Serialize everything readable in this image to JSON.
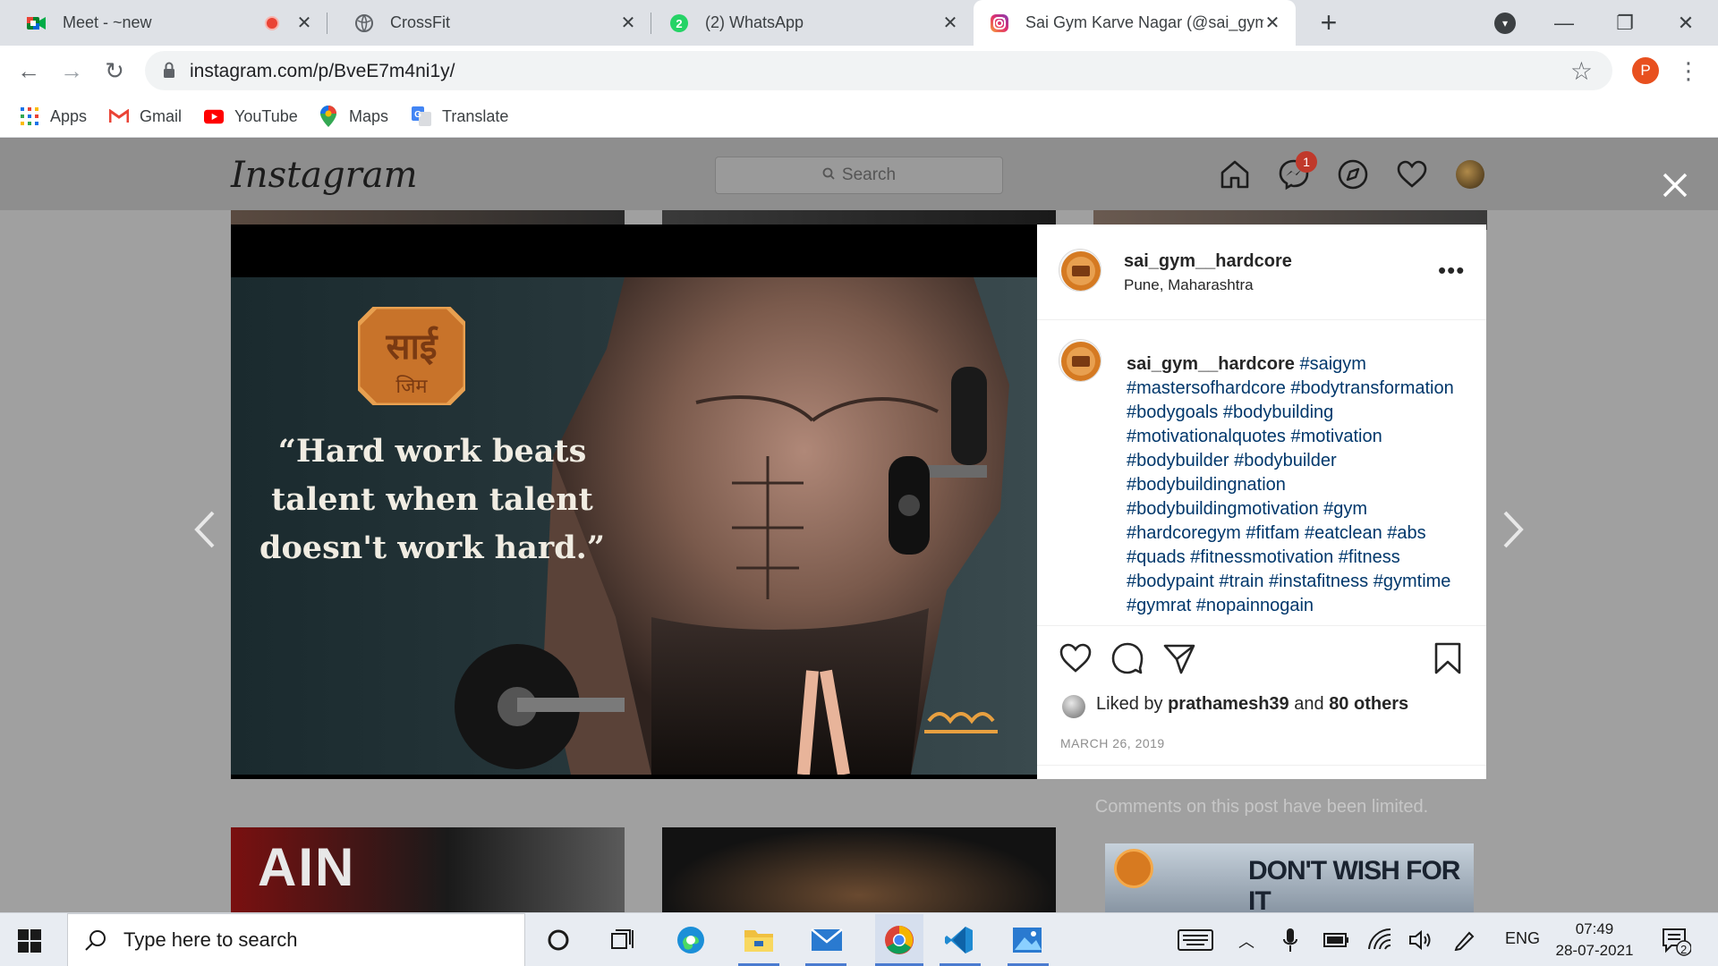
{
  "tabs": [
    {
      "title": "Meet - ~new",
      "icon": "google-meet-icon"
    },
    {
      "title": "CrossFit",
      "icon": "globe-icon"
    },
    {
      "title": "(2) WhatsApp",
      "icon": "whatsapp-icon",
      "badge": "2"
    },
    {
      "title": "Sai Gym Karve Nagar (@sai_gym_",
      "icon": "instagram-icon",
      "active": true
    }
  ],
  "omnibox": {
    "url": "instagram.com/p/BveE7m4ni1y/"
  },
  "profile_initial": "P",
  "bookmarks": [
    {
      "label": "Apps",
      "icon": "apps-grid-icon"
    },
    {
      "label": "Gmail",
      "icon": "gmail-icon"
    },
    {
      "label": "YouTube",
      "icon": "youtube-icon"
    },
    {
      "label": "Maps",
      "icon": "maps-pin-icon"
    },
    {
      "label": "Translate",
      "icon": "translate-icon"
    }
  ],
  "instagram": {
    "logo_text": "Instagram",
    "search_placeholder": "Search",
    "messages_badge": "1"
  },
  "post": {
    "quote": "“Hard work beats talent when talent doesn't work hard.”",
    "logo_glyph": "साई",
    "logo_sub": "जिम",
    "username": "sai_gym__hardcore",
    "location": "Pune, Maharashtra",
    "caption_user": "sai_gym__hardcore",
    "caption_tags": "#saigym #mastersofhardcore #bodytransformation #bodygoals #bodybuilding #motivationalquotes #motivation #bodybuilder #bodybuilder #bodybuildingnation #bodybuildingmotivation #gym #hardcoregym #fitfam #eatclean #abs #quads #fitnessmotivation #fitness #bodypaint #train #instafitness #gymtime #gymrat #nopainnogain",
    "liked_by_prefix": "Liked by",
    "liked_by_user": "prathamesh39",
    "liked_by_and": "and",
    "liked_by_others": "80 others",
    "date": "MARCH 26, 2019",
    "comments_limited": "Comments on this post have been limited."
  },
  "grid_tiles": {
    "bottom_left_text": "AIN",
    "bottom_right_text": "DON'T WISH FOR IT"
  },
  "taskbar": {
    "search_placeholder": "Type here to search",
    "language": "ENG",
    "time": "07:49",
    "date": "28-07-2021",
    "notification_count": "2"
  }
}
